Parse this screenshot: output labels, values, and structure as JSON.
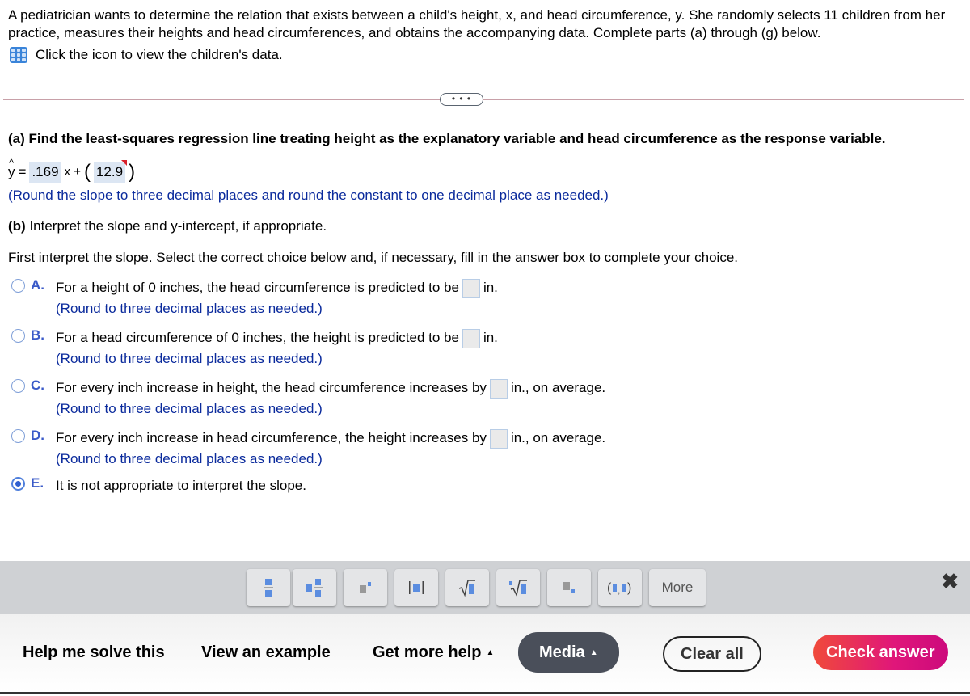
{
  "intro": {
    "text": "A pediatrician wants to determine the relation that exists between a child's height, x, and head circumference, y. She randomly selects 11 children from her practice, measures their heights and head circumferences, and obtains the accompanying data. Complete parts (a) through (g) below.",
    "data_link": "Click the icon to view the children's data."
  },
  "divider_label": "• • •",
  "part_a": {
    "prompt": "(a) Find the least-squares regression line treating height as the explanatory variable and head circumference as the response variable.",
    "yhat": "y",
    "equals": "=",
    "slope": ".169",
    "x_plus": "x +",
    "constant": "12.9",
    "hint": "(Round the slope to three decimal places and round the constant to one decimal place as needed.)"
  },
  "part_b": {
    "prompt": "(b) Interpret the slope and y-intercept, if appropriate.",
    "instruction": "First interpret the slope. Select the correct choice below and, if necessary, fill in the answer box to complete your choice.",
    "choices": [
      {
        "letter": "A.",
        "text": "For a height of 0 inches, the head circumference is predicted to be",
        "unit": "in.",
        "hint": "(Round to three decimal places as needed.)",
        "selected": false
      },
      {
        "letter": "B.",
        "text": "For a head circumference of 0 inches, the height is predicted to be",
        "unit": "in.",
        "hint": "(Round to three decimal places as needed.)",
        "selected": false
      },
      {
        "letter": "C.",
        "text": "For every inch increase in height, the head circumference increases by",
        "unit": "in., on average.",
        "hint": "(Round to three decimal places as needed.)",
        "selected": false
      },
      {
        "letter": "D.",
        "text": "For every inch increase in head circumference, the height increases by",
        "unit": "in., on average.",
        "hint": "(Round to three decimal places as needed.)",
        "selected": false
      },
      {
        "letter": "E.",
        "text": "It is not appropriate to interpret the slope.",
        "selected": true
      }
    ]
  },
  "toolbar": {
    "buttons": [
      "fraction",
      "mixed-number",
      "exponent",
      "absolute-value",
      "square-root",
      "nth-root",
      "subscript",
      "ordered-pair"
    ],
    "more_label": "More",
    "close_label": "✖"
  },
  "footer": {
    "help": "Help me solve this",
    "example": "View an example",
    "more_help": "Get more help",
    "media": "Media",
    "clear": "Clear all",
    "check": "Check answer",
    "caret": "▲"
  }
}
